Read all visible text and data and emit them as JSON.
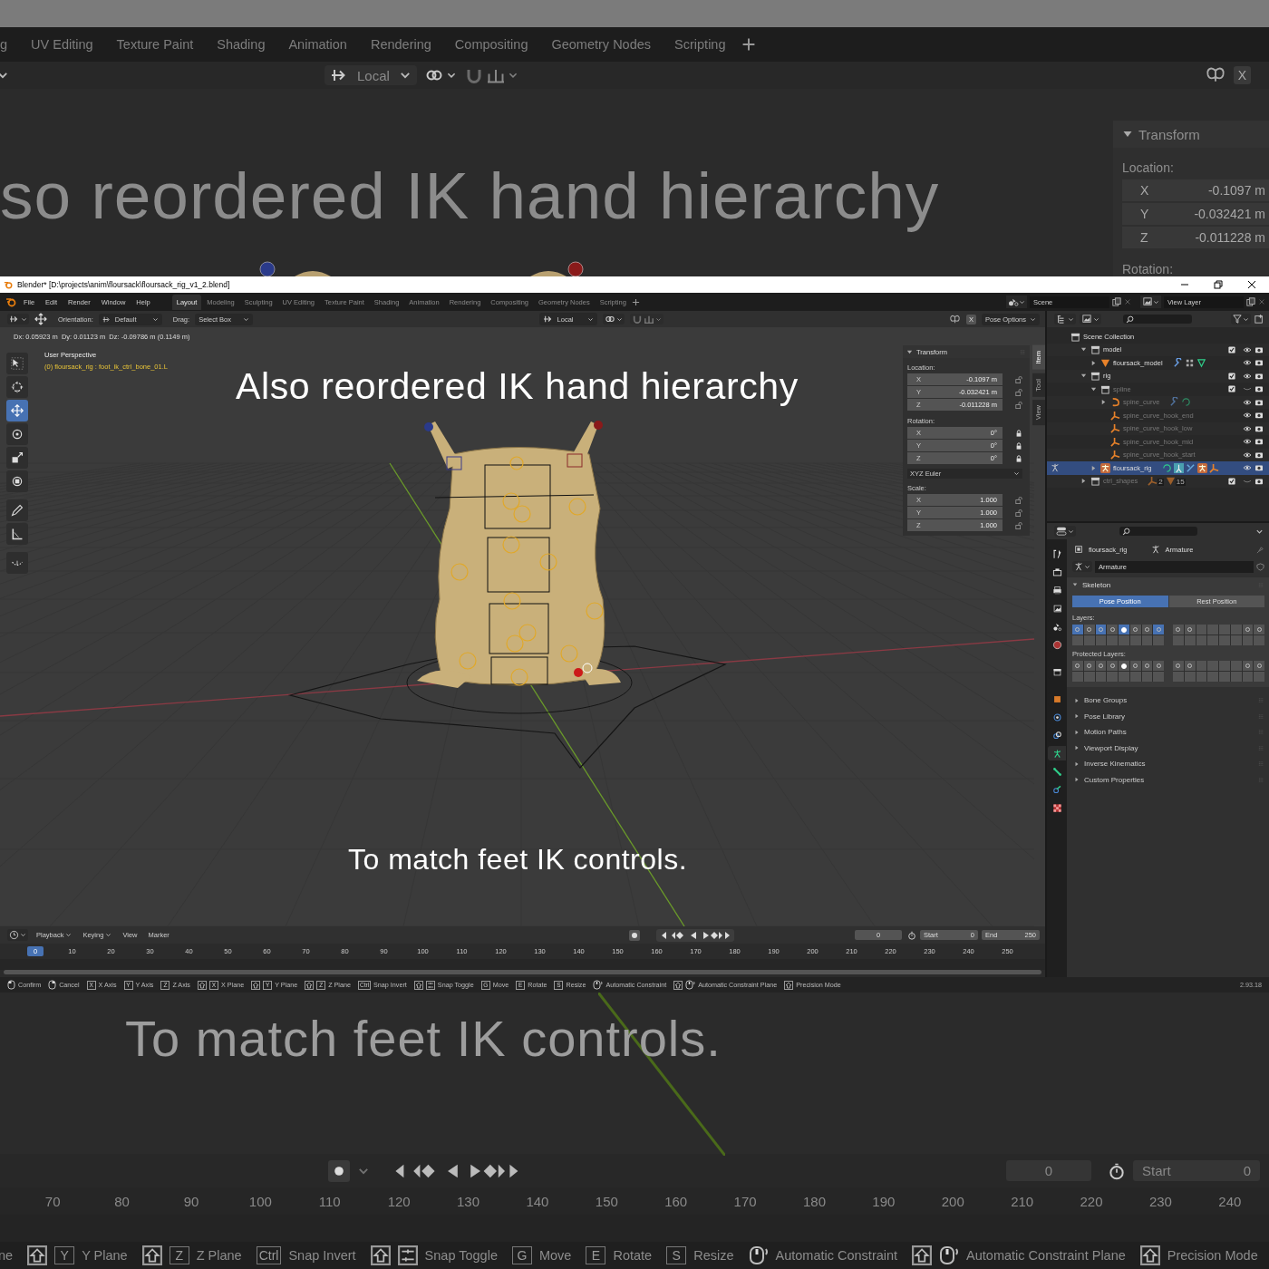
{
  "backdrop_top": {
    "tabs": [
      "g",
      "UV Editing",
      "Texture Paint",
      "Shading",
      "Animation",
      "Rendering",
      "Compositing",
      "Geometry Nodes",
      "Scripting"
    ],
    "pivot": "Local",
    "mirror_x": "X",
    "caption": "so reordered IK hand hierarchy",
    "transform": {
      "title": "Transform",
      "location_label": "Location:",
      "fields": [
        {
          "axis": "X",
          "value": "-0.1097 m"
        },
        {
          "axis": "Y",
          "value": "-0.032421 m"
        },
        {
          "axis": "Z",
          "value": "-0.011228 m"
        }
      ],
      "rotation_label": "Rotation:"
    }
  },
  "window": {
    "title": "Blender* [D:\\projects\\anim\\floursack\\floursack_rig_v1_2.blend]",
    "menus": [
      "File",
      "Edit",
      "Render",
      "Window",
      "Help"
    ],
    "workspaces": [
      {
        "label": "Layout",
        "selected": true
      },
      {
        "label": "Modeling",
        "selected": false
      },
      {
        "label": "Sculpting",
        "selected": false
      },
      {
        "label": "UV Editing",
        "selected": false
      },
      {
        "label": "Texture Paint",
        "selected": false
      },
      {
        "label": "Shading",
        "selected": false
      },
      {
        "label": "Animation",
        "selected": false
      },
      {
        "label": "Rendering",
        "selected": false
      },
      {
        "label": "Compositing",
        "selected": false
      },
      {
        "label": "Geometry Nodes",
        "selected": false
      },
      {
        "label": "Scripting",
        "selected": false
      }
    ],
    "scene": "Scene",
    "view_layer": "View Layer",
    "toolbar": {
      "orientation_label": "Orientation:",
      "orientation": "Default",
      "drag_label": "Drag:",
      "drag": "Select Box",
      "pivot": "Local",
      "mirror_x": "X",
      "pose_options": "Pose Options"
    },
    "viewport": {
      "header_info": "Dx: 0.05923 m  Dy: 0.01123 m  Dz: -0.09786 m (0.1149 m)",
      "perspective": "User Perspective",
      "selection": "(0) floursack_rig : foot_ik_ctrl_bone_01.L",
      "caption_top": "Also reordered IK hand hierarchy",
      "caption_bottom": "To match feet IK controls.",
      "tools": [
        {
          "kind": "select",
          "selected": false
        },
        {
          "kind": "cursor",
          "selected": false
        },
        {
          "kind": "move",
          "selected": true
        },
        {
          "kind": "rotate",
          "selected": false
        },
        {
          "kind": "scale",
          "selected": false
        },
        {
          "kind": "transform",
          "selected": false
        },
        {
          "kind": "annotate",
          "selected": false
        },
        {
          "kind": "measure",
          "selected": false
        },
        {
          "kind": "bend",
          "selected": false
        }
      ],
      "side_tabs": [
        {
          "label": "Item",
          "selected": true
        },
        {
          "label": "Tool",
          "selected": false
        },
        {
          "label": "View",
          "selected": false
        }
      ]
    },
    "n_panel": {
      "title": "Transform",
      "location_label": "Location:",
      "location": [
        {
          "axis": "X",
          "value": "-0.1097 m",
          "locked": false
        },
        {
          "axis": "Y",
          "value": "-0.032421 m",
          "locked": false
        },
        {
          "axis": "Z",
          "value": "-0.011228 m",
          "locked": false
        }
      ],
      "rotation_label": "Rotation:",
      "rotation": [
        {
          "axis": "X",
          "value": "0°",
          "locked": true
        },
        {
          "axis": "Y",
          "value": "0°",
          "locked": true
        },
        {
          "axis": "Z",
          "value": "0°",
          "locked": true
        }
      ],
      "rotation_mode": "XYZ Euler",
      "scale_label": "Scale:",
      "scale": [
        {
          "axis": "X",
          "value": "1.000",
          "locked": false
        },
        {
          "axis": "Y",
          "value": "1.000",
          "locked": false
        },
        {
          "axis": "Z",
          "value": "1.000",
          "locked": false
        }
      ]
    },
    "outliner": {
      "root": "Scene Collection",
      "items": [
        {
          "name": "model",
          "kind": "collection",
          "expanded": true,
          "checked": true,
          "visible": true,
          "selected": false,
          "pose_mode": false,
          "children": [
            {
              "name": "floursack_model",
              "kind": "mesh",
              "expanded": false,
              "visible": true,
              "selected": false,
              "pose_mode": false,
              "extras": [
                {
                  "kind": "modifier"
                },
                {
                  "kind": "vertex_groups"
                },
                {
                  "kind": "mesh_data"
                }
              ]
            }
          ]
        },
        {
          "name": "rig",
          "kind": "collection",
          "expanded": true,
          "checked": true,
          "visible": true,
          "selected": false,
          "pose_mode": false,
          "children": [
            {
              "name": "spline",
              "kind": "collection",
              "expanded": true,
              "checked": true,
              "visible": false,
              "selected": false,
              "pose_mode": false,
              "children": [
                {
                  "name": "spine_curve",
                  "kind": "curve",
                  "expanded": false,
                  "visible": true,
                  "selected": false,
                  "pose_mode": false,
                  "extras": [
                    {
                      "kind": "modifier"
                    },
                    {
                      "kind": "curve_data"
                    }
                  ]
                },
                {
                  "name": "spine_curve_hook_end",
                  "kind": "empty",
                  "visible": true,
                  "selected": false,
                  "pose_mode": false
                },
                {
                  "name": "spine_curve_hook_low",
                  "kind": "empty",
                  "visible": true,
                  "selected": false,
                  "pose_mode": false
                },
                {
                  "name": "spine_curve_hook_mid",
                  "kind": "empty",
                  "visible": true,
                  "selected": false,
                  "pose_mode": false
                },
                {
                  "name": "spine_curve_hook_start",
                  "kind": "empty",
                  "visible": true,
                  "selected": false,
                  "pose_mode": false
                }
              ]
            },
            {
              "name": "floursack_rig",
              "kind": "armature",
              "expanded": false,
              "visible": true,
              "selected": true,
              "pose_mode": true,
              "extras": [
                {
                  "kind": "curve_data"
                },
                {
                  "kind": "pose"
                },
                {
                  "kind": "armature_data"
                },
                {
                  "kind": "armature"
                },
                {
                  "kind": "empty"
                }
              ]
            }
          ]
        },
        {
          "name": "ctrl_shapes",
          "kind": "collection",
          "expanded": false,
          "checked": true,
          "visible": false,
          "selected": false,
          "pose_mode": false,
          "extras": [
            {
              "kind": "empty",
              "count": "2"
            },
            {
              "kind": "mesh",
              "count": "15"
            }
          ]
        }
      ]
    },
    "properties": {
      "tabs": [
        {
          "kind": "tool",
          "selected": false
        },
        {
          "kind": "render",
          "selected": false
        },
        {
          "kind": "output",
          "selected": false
        },
        {
          "kind": "view_layer",
          "selected": false
        },
        {
          "kind": "scene",
          "selected": false
        },
        {
          "kind": "world",
          "selected": false
        },
        {
          "kind": "collection",
          "selected": false
        },
        {
          "kind": "object",
          "selected": false
        },
        {
          "kind": "physics",
          "selected": false
        },
        {
          "kind": "constraints",
          "selected": false
        },
        {
          "kind": "object_data",
          "selected": true
        },
        {
          "kind": "bone",
          "selected": false
        },
        {
          "kind": "bone_constraints",
          "selected": false
        },
        {
          "kind": "texture",
          "selected": false
        }
      ],
      "object": "floursack_rig",
      "data": "Armature",
      "data_name": "Armature",
      "panel": "Skeleton",
      "positions": [
        {
          "label": "Pose Position",
          "selected": true
        },
        {
          "label": "Rest Position",
          "selected": false
        }
      ],
      "layers_label": "Layers:",
      "layers": [
        {
          "on": true,
          "used": true,
          "active": false
        },
        {
          "on": false,
          "used": true,
          "active": false
        },
        {
          "on": true,
          "used": true,
          "active": false
        },
        {
          "on": false,
          "used": true,
          "active": false
        },
        {
          "on": true,
          "used": true,
          "active": true
        },
        {
          "on": false,
          "used": true,
          "active": false
        },
        {
          "on": false,
          "used": true,
          "active": false
        },
        {
          "on": true,
          "used": true,
          "active": false
        },
        {
          "on": false,
          "used": true,
          "active": false
        },
        {
          "on": false,
          "used": true,
          "active": false
        },
        {
          "on": false,
          "used": false,
          "active": false
        },
        {
          "on": false,
          "used": false,
          "active": false
        },
        {
          "on": false,
          "used": false,
          "active": false
        },
        {
          "on": false,
          "used": false,
          "active": false
        },
        {
          "on": false,
          "used": true,
          "active": false
        },
        {
          "on": false,
          "used": true,
          "active": false
        },
        {
          "on": false,
          "used": false,
          "active": false
        },
        {
          "on": false,
          "used": false,
          "active": false
        },
        {
          "on": false,
          "used": false,
          "active": false
        },
        {
          "on": false,
          "used": false,
          "active": false
        },
        {
          "on": false,
          "used": false,
          "active": false
        },
        {
          "on": false,
          "used": false,
          "active": false
        },
        {
          "on": false,
          "used": false,
          "active": false
        },
        {
          "on": false,
          "used": false,
          "active": false
        },
        {
          "on": false,
          "used": false,
          "active": false
        },
        {
          "on": false,
          "used": false,
          "active": false
        },
        {
          "on": false,
          "used": false,
          "active": false
        },
        {
          "on": false,
          "used": false,
          "active": false
        },
        {
          "on": false,
          "used": false,
          "active": false
        },
        {
          "on": false,
          "used": false,
          "active": false
        },
        {
          "on": false,
          "used": false,
          "active": false
        },
        {
          "on": false,
          "used": false,
          "active": false
        }
      ],
      "protected_label": "Protected Layers:",
      "protected": [
        {
          "on": false,
          "used": true,
          "active": false
        },
        {
          "on": false,
          "used": true,
          "active": false
        },
        {
          "on": false,
          "used": true,
          "active": false
        },
        {
          "on": false,
          "used": true,
          "active": false
        },
        {
          "on": false,
          "used": true,
          "active": true
        },
        {
          "on": false,
          "used": true,
          "active": false
        },
        {
          "on": false,
          "used": true,
          "active": false
        },
        {
          "on": false,
          "used": true,
          "active": false
        },
        {
          "on": false,
          "used": true,
          "active": false
        },
        {
          "on": false,
          "used": true,
          "active": false
        },
        {
          "on": false,
          "used": false,
          "active": false
        },
        {
          "on": false,
          "used": false,
          "active": false
        },
        {
          "on": false,
          "used": false,
          "active": false
        },
        {
          "on": false,
          "used": false,
          "active": false
        },
        {
          "on": false,
          "used": true,
          "active": false
        },
        {
          "on": false,
          "used": true,
          "active": false
        },
        {
          "on": false,
          "used": false,
          "active": false
        },
        {
          "on": false,
          "used": false,
          "active": false
        },
        {
          "on": false,
          "used": false,
          "active": false
        },
        {
          "on": false,
          "used": false,
          "active": false
        },
        {
          "on": false,
          "used": false,
          "active": false
        },
        {
          "on": false,
          "used": false,
          "active": false
        },
        {
          "on": false,
          "used": false,
          "active": false
        },
        {
          "on": false,
          "used": false,
          "active": false
        },
        {
          "on": false,
          "used": false,
          "active": false
        },
        {
          "on": false,
          "used": false,
          "active": false
        },
        {
          "on": false,
          "used": false,
          "active": false
        },
        {
          "on": false,
          "used": false,
          "active": false
        },
        {
          "on": false,
          "used": false,
          "active": false
        },
        {
          "on": false,
          "used": false,
          "active": false
        },
        {
          "on": false,
          "used": false,
          "active": false
        },
        {
          "on": false,
          "used": false,
          "active": false
        }
      ],
      "subpanels": [
        "Bone Groups",
        "Pose Library",
        "Motion Paths",
        "Viewport Display",
        "Inverse Kinematics",
        "Custom Properties"
      ]
    },
    "timeline": {
      "menus": [
        "Playback",
        "Keying",
        "View",
        "Marker"
      ],
      "current_frame": "0",
      "start_label": "Start",
      "start": "0",
      "end_label": "End",
      "end": "250",
      "frame_marker": "0",
      "ticks": [
        "10",
        "20",
        "30",
        "40",
        "50",
        "60",
        "70",
        "80",
        "90",
        "100",
        "110",
        "120",
        "130",
        "140",
        "150",
        "160",
        "170",
        "180",
        "190",
        "200",
        "210",
        "220",
        "230",
        "240",
        "250"
      ]
    },
    "status_bar": {
      "items": [
        {
          "keys": [
            {
              "kind": "mouse_left"
            }
          ],
          "label": "Confirm"
        },
        {
          "keys": [
            {
              "kind": "mouse_right"
            }
          ],
          "label": "Cancel"
        },
        {
          "keys": [
            {
              "kind": "key",
              "text": "X"
            }
          ],
          "label": "X Axis"
        },
        {
          "keys": [
            {
              "kind": "key",
              "text": "Y"
            }
          ],
          "label": "Y Axis"
        },
        {
          "keys": [
            {
              "kind": "key",
              "text": "Z"
            }
          ],
          "label": "Z Axis"
        },
        {
          "keys": [
            {
              "kind": "shift"
            },
            {
              "kind": "key",
              "text": "X"
            }
          ],
          "label": "X Plane"
        },
        {
          "keys": [
            {
              "kind": "shift"
            },
            {
              "kind": "key",
              "text": "Y"
            }
          ],
          "label": "Y Plane"
        },
        {
          "keys": [
            {
              "kind": "shift"
            },
            {
              "kind": "key",
              "text": "Z"
            }
          ],
          "label": "Z Plane"
        },
        {
          "keys": [
            {
              "kind": "key",
              "text": "Ctrl"
            }
          ],
          "label": "Snap Invert"
        },
        {
          "keys": [
            {
              "kind": "shift"
            },
            {
              "kind": "snap"
            }
          ],
          "label": "Snap Toggle"
        },
        {
          "keys": [
            {
              "kind": "key",
              "text": "G"
            }
          ],
          "label": "Move"
        },
        {
          "keys": [
            {
              "kind": "key",
              "text": "E"
            }
          ],
          "label": "Rotate"
        },
        {
          "keys": [
            {
              "kind": "key",
              "text": "S"
            }
          ],
          "label": "Resize"
        },
        {
          "keys": [
            {
              "kind": "mouse_middle"
            }
          ],
          "label": "Automatic Constraint"
        },
        {
          "keys": [
            {
              "kind": "shift"
            },
            {
              "kind": "mouse_middle"
            }
          ],
          "label": "Automatic Constraint Plane"
        },
        {
          "keys": [
            {
              "kind": "shift"
            }
          ],
          "label": "Precision Mode"
        }
      ],
      "version": "2.93.18"
    }
  },
  "backdrop_bottom": {
    "caption": "To match feet IK controls.",
    "current_frame": "0",
    "start_label": "Start",
    "start": "0",
    "ticks": [
      "70",
      "80",
      "90",
      "100",
      "110",
      "120",
      "130",
      "140",
      "150",
      "160",
      "170",
      "180",
      "190",
      "200",
      "210",
      "220",
      "230",
      "240"
    ],
    "status_items": [
      {
        "label": "ne"
      },
      {
        "keys": [
          {
            "kind": "shift"
          },
          {
            "kind": "key",
            "text": "Y"
          }
        ],
        "label": "Y Plane"
      },
      {
        "keys": [
          {
            "kind": "shift"
          },
          {
            "kind": "key",
            "text": "Z"
          }
        ],
        "label": "Z Plane"
      },
      {
        "keys": [
          {
            "kind": "key",
            "text": "Ctrl"
          }
        ],
        "label": "Snap Invert"
      },
      {
        "keys": [
          {
            "kind": "shift"
          },
          {
            "kind": "snap"
          }
        ],
        "label": "Snap Toggle"
      },
      {
        "keys": [
          {
            "kind": "key",
            "text": "G"
          }
        ],
        "label": "Move"
      },
      {
        "keys": [
          {
            "kind": "key",
            "text": "E"
          }
        ],
        "label": "Rotate"
      },
      {
        "keys": [
          {
            "kind": "key",
            "text": "S"
          }
        ],
        "label": "Resize"
      },
      {
        "keys": [
          {
            "kind": "mouse_middle"
          }
        ],
        "label": "Automatic Constraint"
      },
      {
        "keys": [
          {
            "kind": "shift"
          },
          {
            "kind": "mouse_middle"
          }
        ],
        "label": "Automatic Constraint Plane"
      },
      {
        "keys": [
          {
            "kind": "shift"
          }
        ],
        "label": "Precision Mode"
      }
    ]
  }
}
